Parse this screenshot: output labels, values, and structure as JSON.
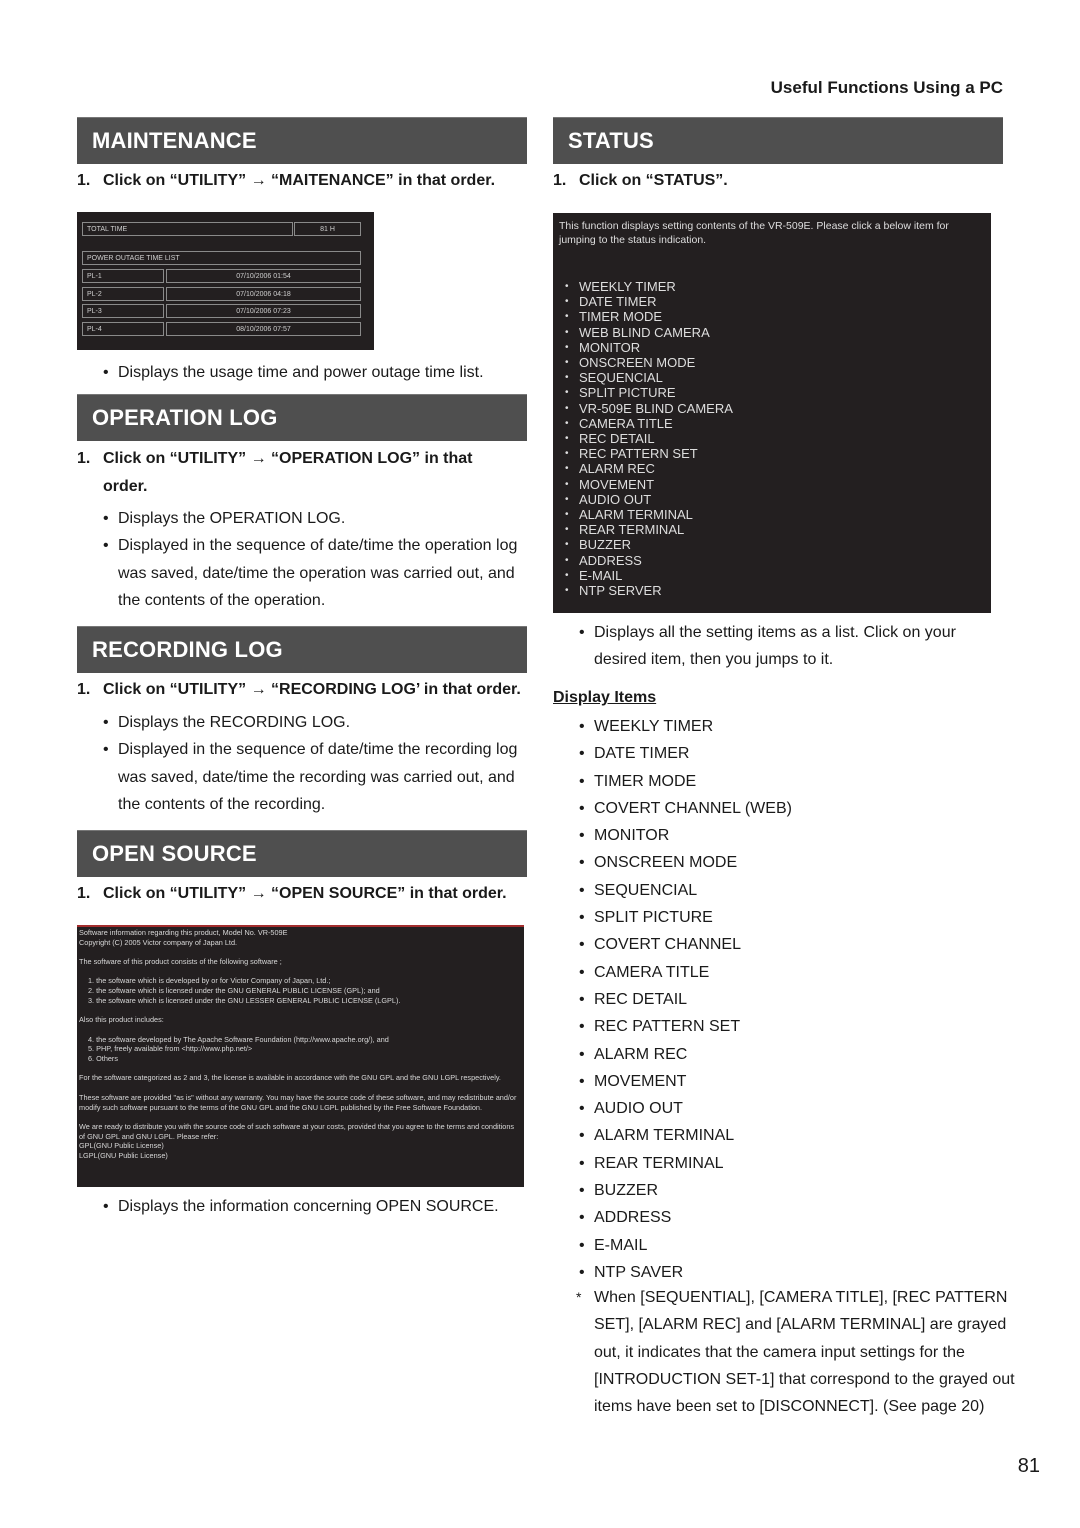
{
  "running_head": "Useful Functions Using a PC",
  "page_number": "81",
  "maintenance": {
    "title": "MAINTENANCE",
    "step_num": "1.",
    "step": "Click on “UTILITY” → “MAITENANCE” in that order.",
    "screen": {
      "total_time_label": "TOTAL TIME",
      "total_time_value": "81 H",
      "list_label": "POWER OUTAGE TIME LIST",
      "rows": [
        {
          "id": "PL-1",
          "datetime": "07/10/2006  01:54"
        },
        {
          "id": "PL-2",
          "datetime": "07/10/2006  04:18"
        },
        {
          "id": "PL-3",
          "datetime": "07/10/2006  07:23"
        },
        {
          "id": "PL-4",
          "datetime": "08/10/2006  07:57"
        }
      ]
    },
    "bullets": [
      "Displays the usage time and power outage time list."
    ]
  },
  "operation_log": {
    "title": "OPERATION LOG",
    "step_num": "1.",
    "step": "Click on “UTILITY” → “OPERATION LOG” in that order.",
    "bullets": [
      "Displays the OPERATION LOG.",
      "Displayed in the sequence of date/time the operation log was saved, date/time the operation was carried out, and the contents of the operation."
    ]
  },
  "recording_log": {
    "title": "RECORDING LOG",
    "step_num": "1.",
    "step": "Click on “UTILITY” → “RECORDING LOG’ in that order.",
    "bullets": [
      "Displays the RECORDING LOG.",
      "Displayed in the sequence of date/time the recording log was saved, date/time the recording was carried out, and the contents of the recording."
    ]
  },
  "open_source": {
    "title": "OPEN SOURCE",
    "step_num": "1.",
    "step": "Click on “UTILITY” → “OPEN SOURCE” in that order.",
    "screen": {
      "line1": "Software information regarding this product, Model No. VR-509E",
      "line2": "Copyright (C) 2005 Victor company of Japan Ltd.",
      "line3": "The software of this product consists of the following software ;",
      "item1": "1.   the software which is developed by or for Victor Company of Japan, Ltd.;",
      "item2": "2.   the software which is licensed under the GNU GENERAL PUBLIC LICENSE (GPL); and",
      "item3": "3.   the software which is licensed under the GNU LESSER GENERAL PUBLIC LICENSE (LGPL).",
      "line4": "Also this product includes:",
      "item4": "4.   the software developed by The Apache Software Foundation (http://www.apache.org/), and",
      "item5": "5.   PHP, freely available from <http://www.php.net/>",
      "item6": "6.   Others",
      "para1": "For the software categorized as 2 and 3, the license is available in accordance with the GNU GPL and the GNU LGPL respectively.",
      "para2": "These software are provided \"as is\" without any warranty. You may have the source code of these software, and may redistribute and/or modify such software pursuant to the terms of the GNU GPL and the GNU LGPL published by the Free Software Foundation.",
      "para3": "We are ready to distribute you with the source code of such software at your costs, provided that you agree to the terms and conditions of GNU GPL and GNU LGPL. Please refer:",
      "link1": "GPL(GNU Public License)",
      "link2": "LGPL(GNU Public License)"
    },
    "bullets": [
      "Displays the information concerning OPEN SOURCE."
    ]
  },
  "status": {
    "title": "STATUS",
    "step_num": "1.",
    "step": "Click on “STATUS”.",
    "screen": {
      "intro": "This function displays setting contents of the VR-509E. Please click a below item for jumping to the status indication.",
      "links": [
        "WEEKLY TIMER",
        "DATE TIMER",
        "TIMER MODE",
        "WEB BLIND CAMERA",
        "MONITOR",
        "ONSCREEN MODE",
        "SEQUENCIAL",
        "SPLIT PICTURE",
        "VR-509E BLIND CAMERA",
        "CAMERA TITLE",
        "REC DETAIL",
        "REC PATTERN SET",
        "ALARM REC",
        "MOVEMENT",
        "AUDIO OUT",
        "ALARM TERMINAL",
        "REAR TERMINAL",
        "BUZZER",
        "ADDRESS",
        "E-MAIL",
        "NTP SERVER"
      ]
    },
    "bullets": [
      "Displays all the setting items as a list. Click on your desired item, then you jumps to it."
    ],
    "display_items_heading": "Display Items",
    "display_items": [
      "WEEKLY TIMER",
      "DATE TIMER",
      "TIMER MODE",
      "COVERT CHANNEL (WEB)",
      "MONITOR",
      "ONSCREEN MODE",
      "SEQUENCIAL",
      "SPLIT PICTURE",
      "COVERT CHANNEL",
      "CAMERA TITLE",
      "REC DETAIL",
      "REC PATTERN SET",
      "ALARM REC",
      "MOVEMENT",
      "AUDIO OUT",
      "ALARM TERMINAL",
      "REAR TERMINAL",
      "BUZZER",
      "ADDRESS",
      "E-MAIL",
      "NTP SAVER"
    ],
    "note_marker": "*",
    "note": "When [SEQUENTIAL], [CAMERA TITLE], [REC PATTERN SET], [ALARM REC] and [ALARM TERMINAL] are grayed out, it indicates that the camera input settings for the [INTRODUCTION SET-1] that correspond to the grayed out items have been set to [DISCONNECT]. (See page 20)"
  }
}
